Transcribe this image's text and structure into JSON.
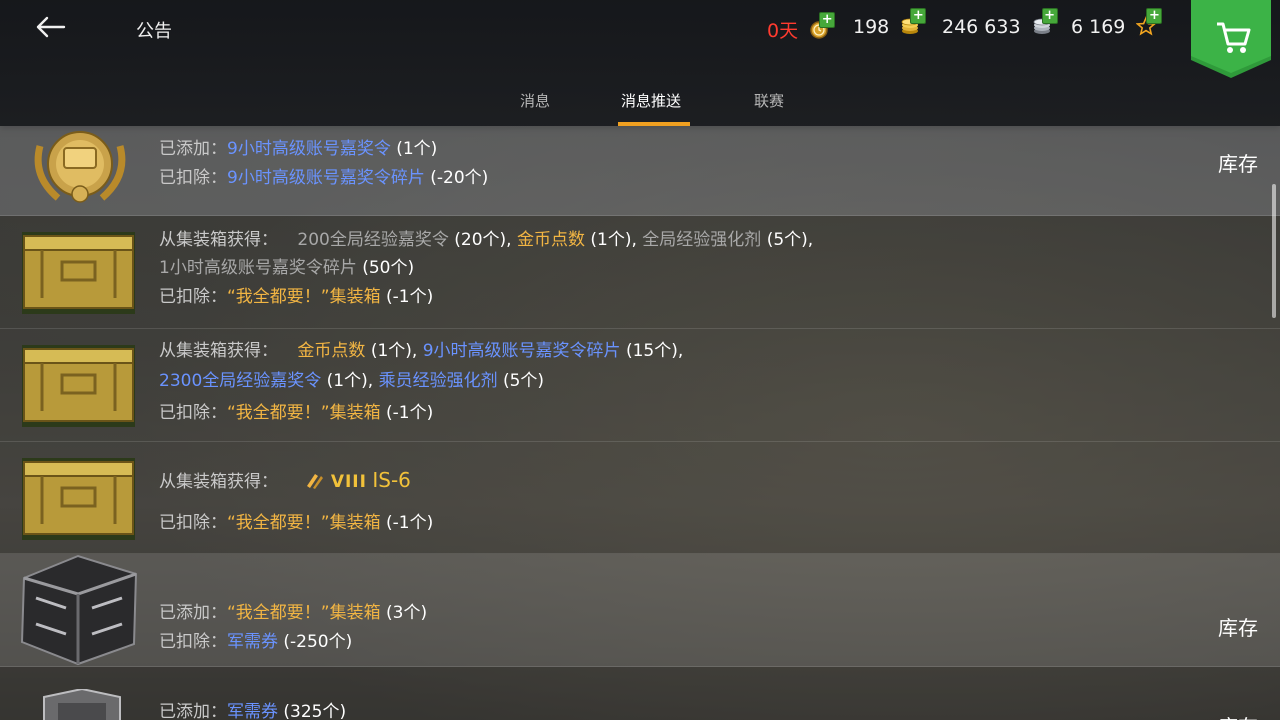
{
  "header": {
    "title": "公告",
    "resources": {
      "premium_days": "0天",
      "gold": "198",
      "silver": "246 633",
      "free_xp": "6 169"
    }
  },
  "tabs": [
    {
      "label": "消息"
    },
    {
      "label": "消息推送",
      "active": true
    },
    {
      "label": "联赛"
    }
  ],
  "messages": [
    {
      "icon": "premium-medal-icon",
      "line1": {
        "label": "已添加：",
        "item": "9小时高级账号嘉奖令",
        "qty": "(1个)"
      },
      "line2": {
        "label": "已扣除：",
        "item": "9小时高级账号嘉奖令碎片",
        "qty": "(-20个)"
      },
      "action": "库存"
    },
    {
      "icon": "gold-crate-icon",
      "obtained_label": "从集装箱获得：",
      "items": [
        {
          "name": "200全局经验嘉奖令",
          "qty": "(20个)"
        },
        {
          "name": "金币点数",
          "qty": "(1个)"
        },
        {
          "name": "全局经验强化剂",
          "qty": "(5个)"
        },
        {
          "name": "1小时高级账号嘉奖令碎片",
          "qty": "(50个)"
        }
      ],
      "deducted": {
        "label": "已扣除：",
        "item": "“我全都要！”集装箱",
        "qty": "(-1个)"
      }
    },
    {
      "icon": "gold-crate-icon",
      "obtained_label": "从集装箱获得：",
      "items": [
        {
          "name": "金币点数",
          "qty": "(1个)"
        },
        {
          "name": "9小时高级账号嘉奖令碎片",
          "qty": "(15个)"
        },
        {
          "name": "2300全局经验嘉奖令",
          "qty": "(1个)"
        },
        {
          "name": "乘员经验强化剂",
          "qty": "(5个)"
        }
      ],
      "deducted": {
        "label": "已扣除：",
        "item": "“我全都要！”集装箱",
        "qty": "(-1个)"
      }
    },
    {
      "icon": "gold-crate-icon",
      "obtained_label": "从集装箱获得：",
      "tank": {
        "tier": "VIII",
        "name": "IS-6"
      },
      "deducted": {
        "label": "已扣除：",
        "item": "“我全都要！”集装箱",
        "qty": "(-1个)"
      }
    },
    {
      "icon": "black-crate-icon",
      "line1": {
        "label": "已添加：",
        "item": "“我全都要！”集装箱",
        "qty": "(3个)"
      },
      "line2": {
        "label": "已扣除：",
        "item": "军需券",
        "qty": "(-250个)"
      },
      "action": "库存"
    },
    {
      "icon": "badge-icon",
      "line1": {
        "label": "已添加：",
        "item": "军需券",
        "qty": "(325个)"
      },
      "action": "库存"
    }
  ],
  "colors": {
    "accent": "#f0a020",
    "link_blue": "#6a93ff",
    "item_gold": "#f2b543",
    "premium_red": "#ff3b2f",
    "shop_green": "#2f9a3a"
  }
}
